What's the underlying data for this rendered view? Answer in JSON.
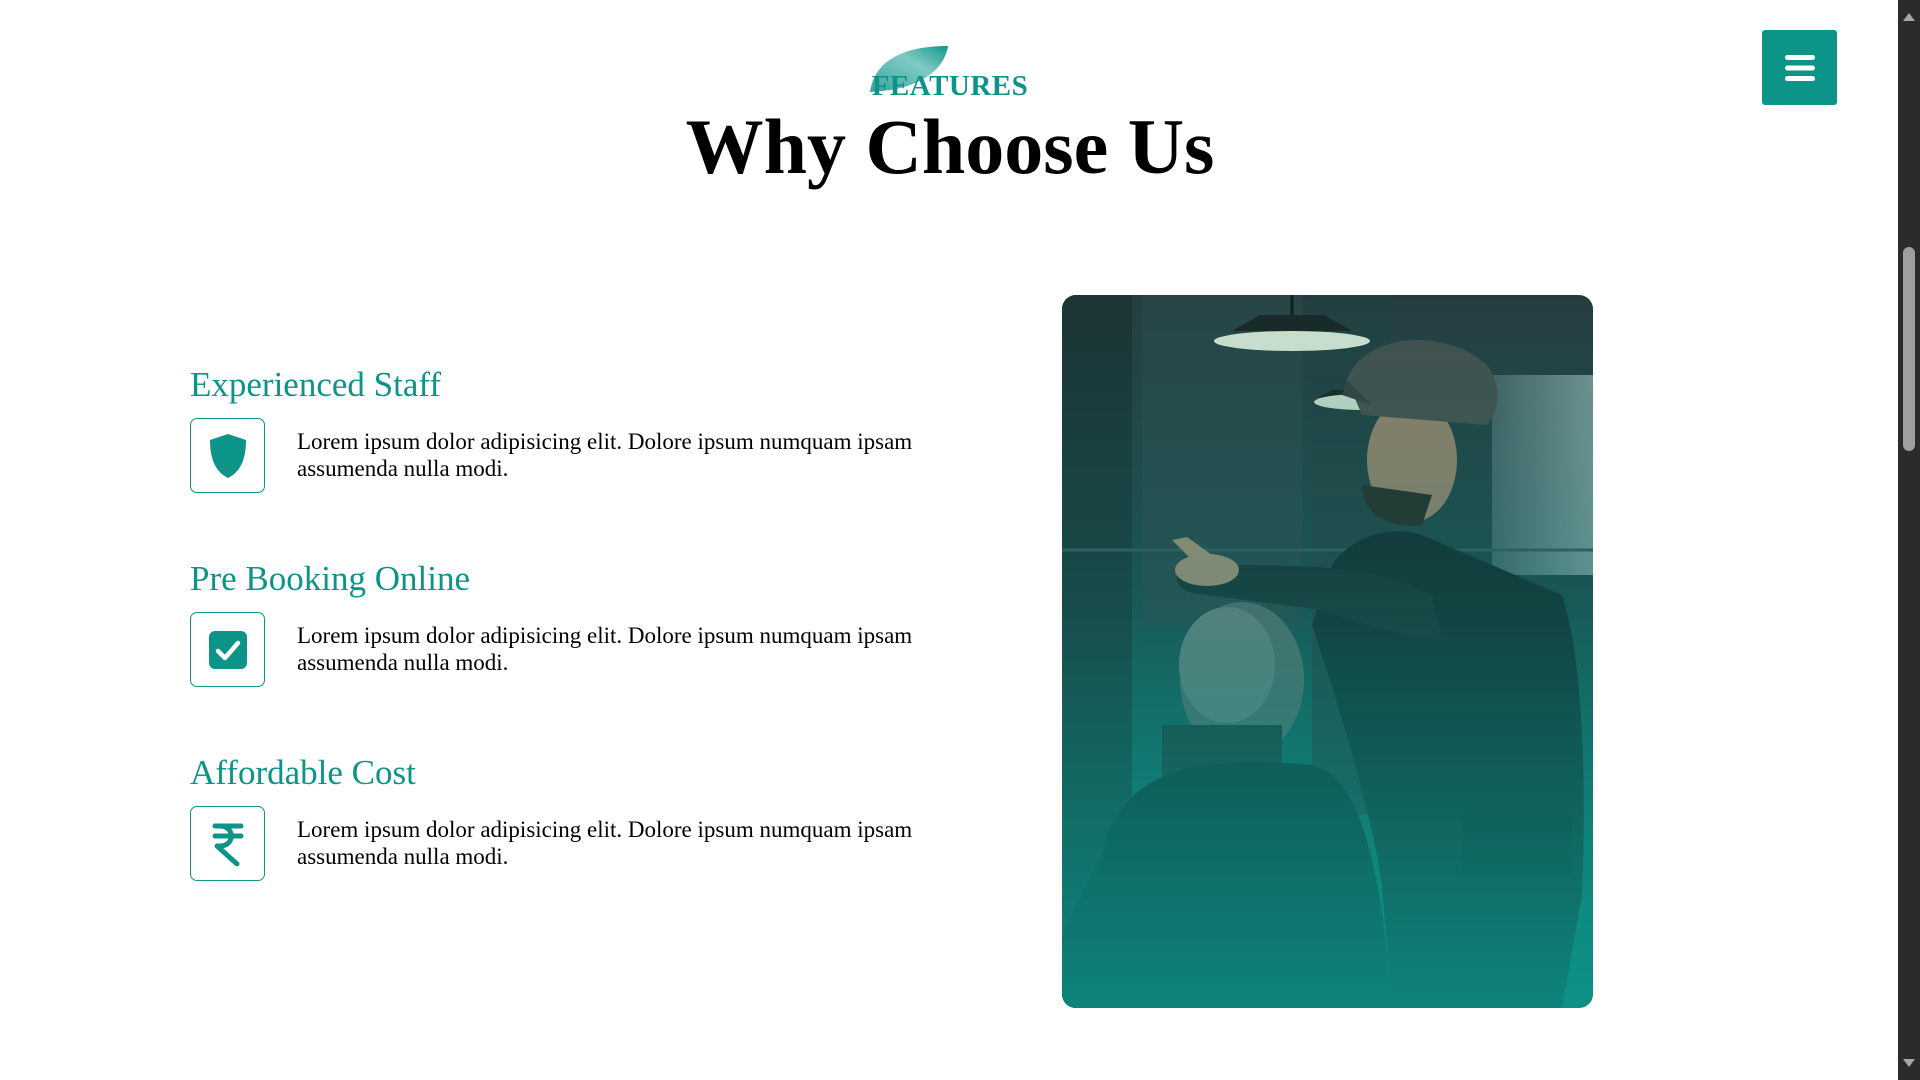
{
  "header": {
    "tag": "FEATURES",
    "title": "Why Choose Us"
  },
  "menu": {
    "icon": "hamburger-icon"
  },
  "features": [
    {
      "title": "Experienced Staff",
      "icon": "shield-icon",
      "text": "Lorem ipsum dolor adipisicing elit. Dolore ipsum numquam ipsam assumenda nulla modi."
    },
    {
      "title": "Pre Booking Online",
      "icon": "checkbox-icon",
      "text": "Lorem ipsum dolor adipisicing elit. Dolore ipsum numquam ipsam assumenda nulla modi."
    },
    {
      "title": "Affordable Cost",
      "icon": "rupee-icon",
      "text": "Lorem ipsum dolor adipisicing elit. Dolore ipsum numquam ipsam assumenda nulla modi."
    }
  ],
  "image": {
    "subject": "barber-cutting-hair-photo"
  },
  "colors": {
    "accent": "#0d9488",
    "text": "#000000",
    "scrollbar": "#2b2b2b"
  }
}
